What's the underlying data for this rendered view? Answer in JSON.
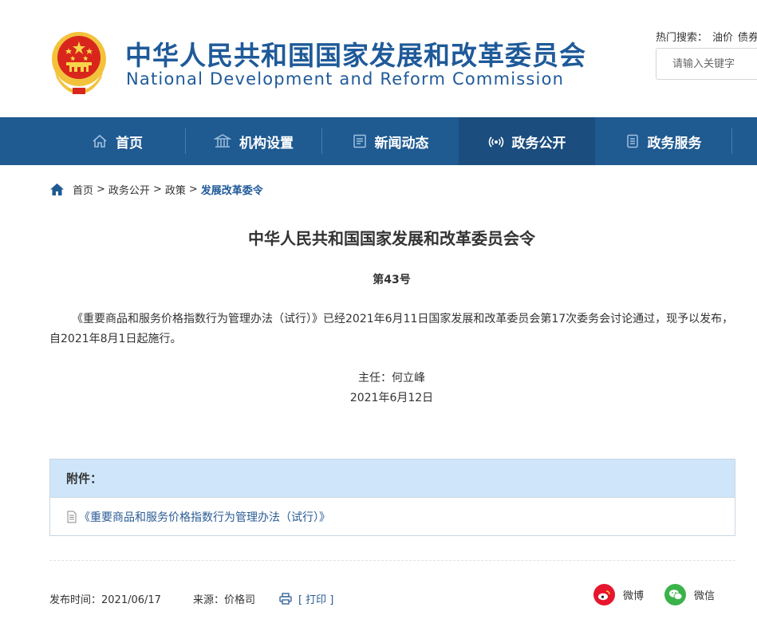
{
  "header": {
    "title_cn": "中华人民共和国国家发展和改革委员会",
    "title_en": "National Development and Reform Commission",
    "hot_search_label": "热门搜索：",
    "hot_search_terms": [
      "油价",
      "债券"
    ],
    "search_placeholder": "请输入关键字"
  },
  "nav": {
    "items": [
      {
        "label": "首页",
        "icon": "home-icon"
      },
      {
        "label": "机构设置",
        "icon": "building-icon"
      },
      {
        "label": "新闻动态",
        "icon": "news-icon"
      },
      {
        "label": "政务公开",
        "icon": "broadcast-icon",
        "active": true
      },
      {
        "label": "政务服务",
        "icon": "document-icon"
      }
    ]
  },
  "breadcrumb": {
    "items": [
      "首页",
      "政务公开",
      "政策",
      "发展改革委令"
    ],
    "separator": ">"
  },
  "article": {
    "title": "中华人民共和国国家发展和改革委员会令",
    "number": "第43号",
    "body": "《重要商品和服务价格指数行为管理办法（试行）》已经2021年6月11日国家发展和改革委员会第17次委务会讨论通过，现予以发布，自2021年8月1日起施行。",
    "signer": "主任：何立峰",
    "sign_date": "2021年6月12日"
  },
  "attachment": {
    "heading": "附件：",
    "link_text": "《重要商品和服务价格指数行为管理办法（试行）》"
  },
  "footer": {
    "publish_time": "发布时间：2021/06/17",
    "source": "来源：价格司",
    "print_label": "[ 打印 ]",
    "share_weibo": "微博",
    "share_wechat": "微信"
  },
  "colors": {
    "brand_blue": "#1f5a99",
    "nav_bg": "#1f5a91",
    "nav_active": "#1b4d7e",
    "attach_head_bg": "#cfe6fa",
    "weibo_red": "#e6162d",
    "wechat_green": "#3bb34a"
  }
}
